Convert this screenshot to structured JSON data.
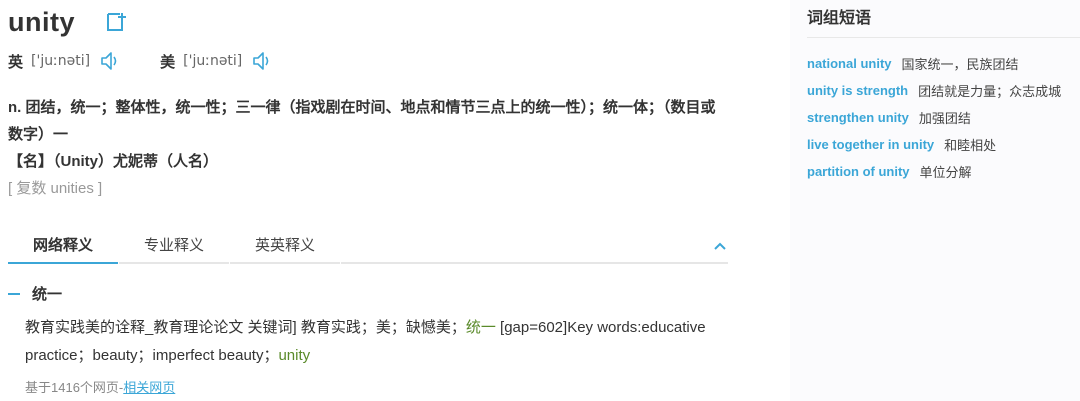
{
  "entry": {
    "word": "unity",
    "pronunciations": [
      {
        "label": "英",
        "ipa": "['juːnəti]"
      },
      {
        "label": "美",
        "ipa": "['juːnəti]"
      }
    ],
    "definitions": [
      "n. 团结，统一；整体性，统一性；三一律（指戏剧在时间、地点和情节三点上的统一性）；统一体；（数目或数字）一",
      "【名】（Unity）尤妮蒂（人名）"
    ],
    "plural": "[ 复数 unities ]"
  },
  "tabs": [
    {
      "label": "网络释义",
      "active": true
    },
    {
      "label": "专业释义",
      "active": false
    },
    {
      "label": "英英释义",
      "active": false
    }
  ],
  "web_sense": {
    "heading": "统一",
    "text_before": "教育实践美的诠释_教育理论论文 关键词] 教育实践；美；缺憾美；",
    "highlight1": "统一",
    "text_middle": " [gap=602]Key words:educative practice；beauty；imperfect beauty；",
    "highlight2": "unity",
    "source_prefix": "基于1416个网页-",
    "source_link": "相关网页"
  },
  "phrases": {
    "title": "词组短语",
    "items": [
      {
        "en": "national unity",
        "zh": "国家统一，民族团结"
      },
      {
        "en": "unity is strength",
        "zh": "团结就是力量；众志成城"
      },
      {
        "en": "strengthen unity",
        "zh": "加强团结"
      },
      {
        "en": "live together in unity",
        "zh": "和睦相处"
      },
      {
        "en": "partition of unity",
        "zh": "单位分解"
      }
    ]
  },
  "colors": {
    "accent": "#3ba6d7",
    "highlight": "#5a8a2a",
    "muted": "#999999"
  }
}
